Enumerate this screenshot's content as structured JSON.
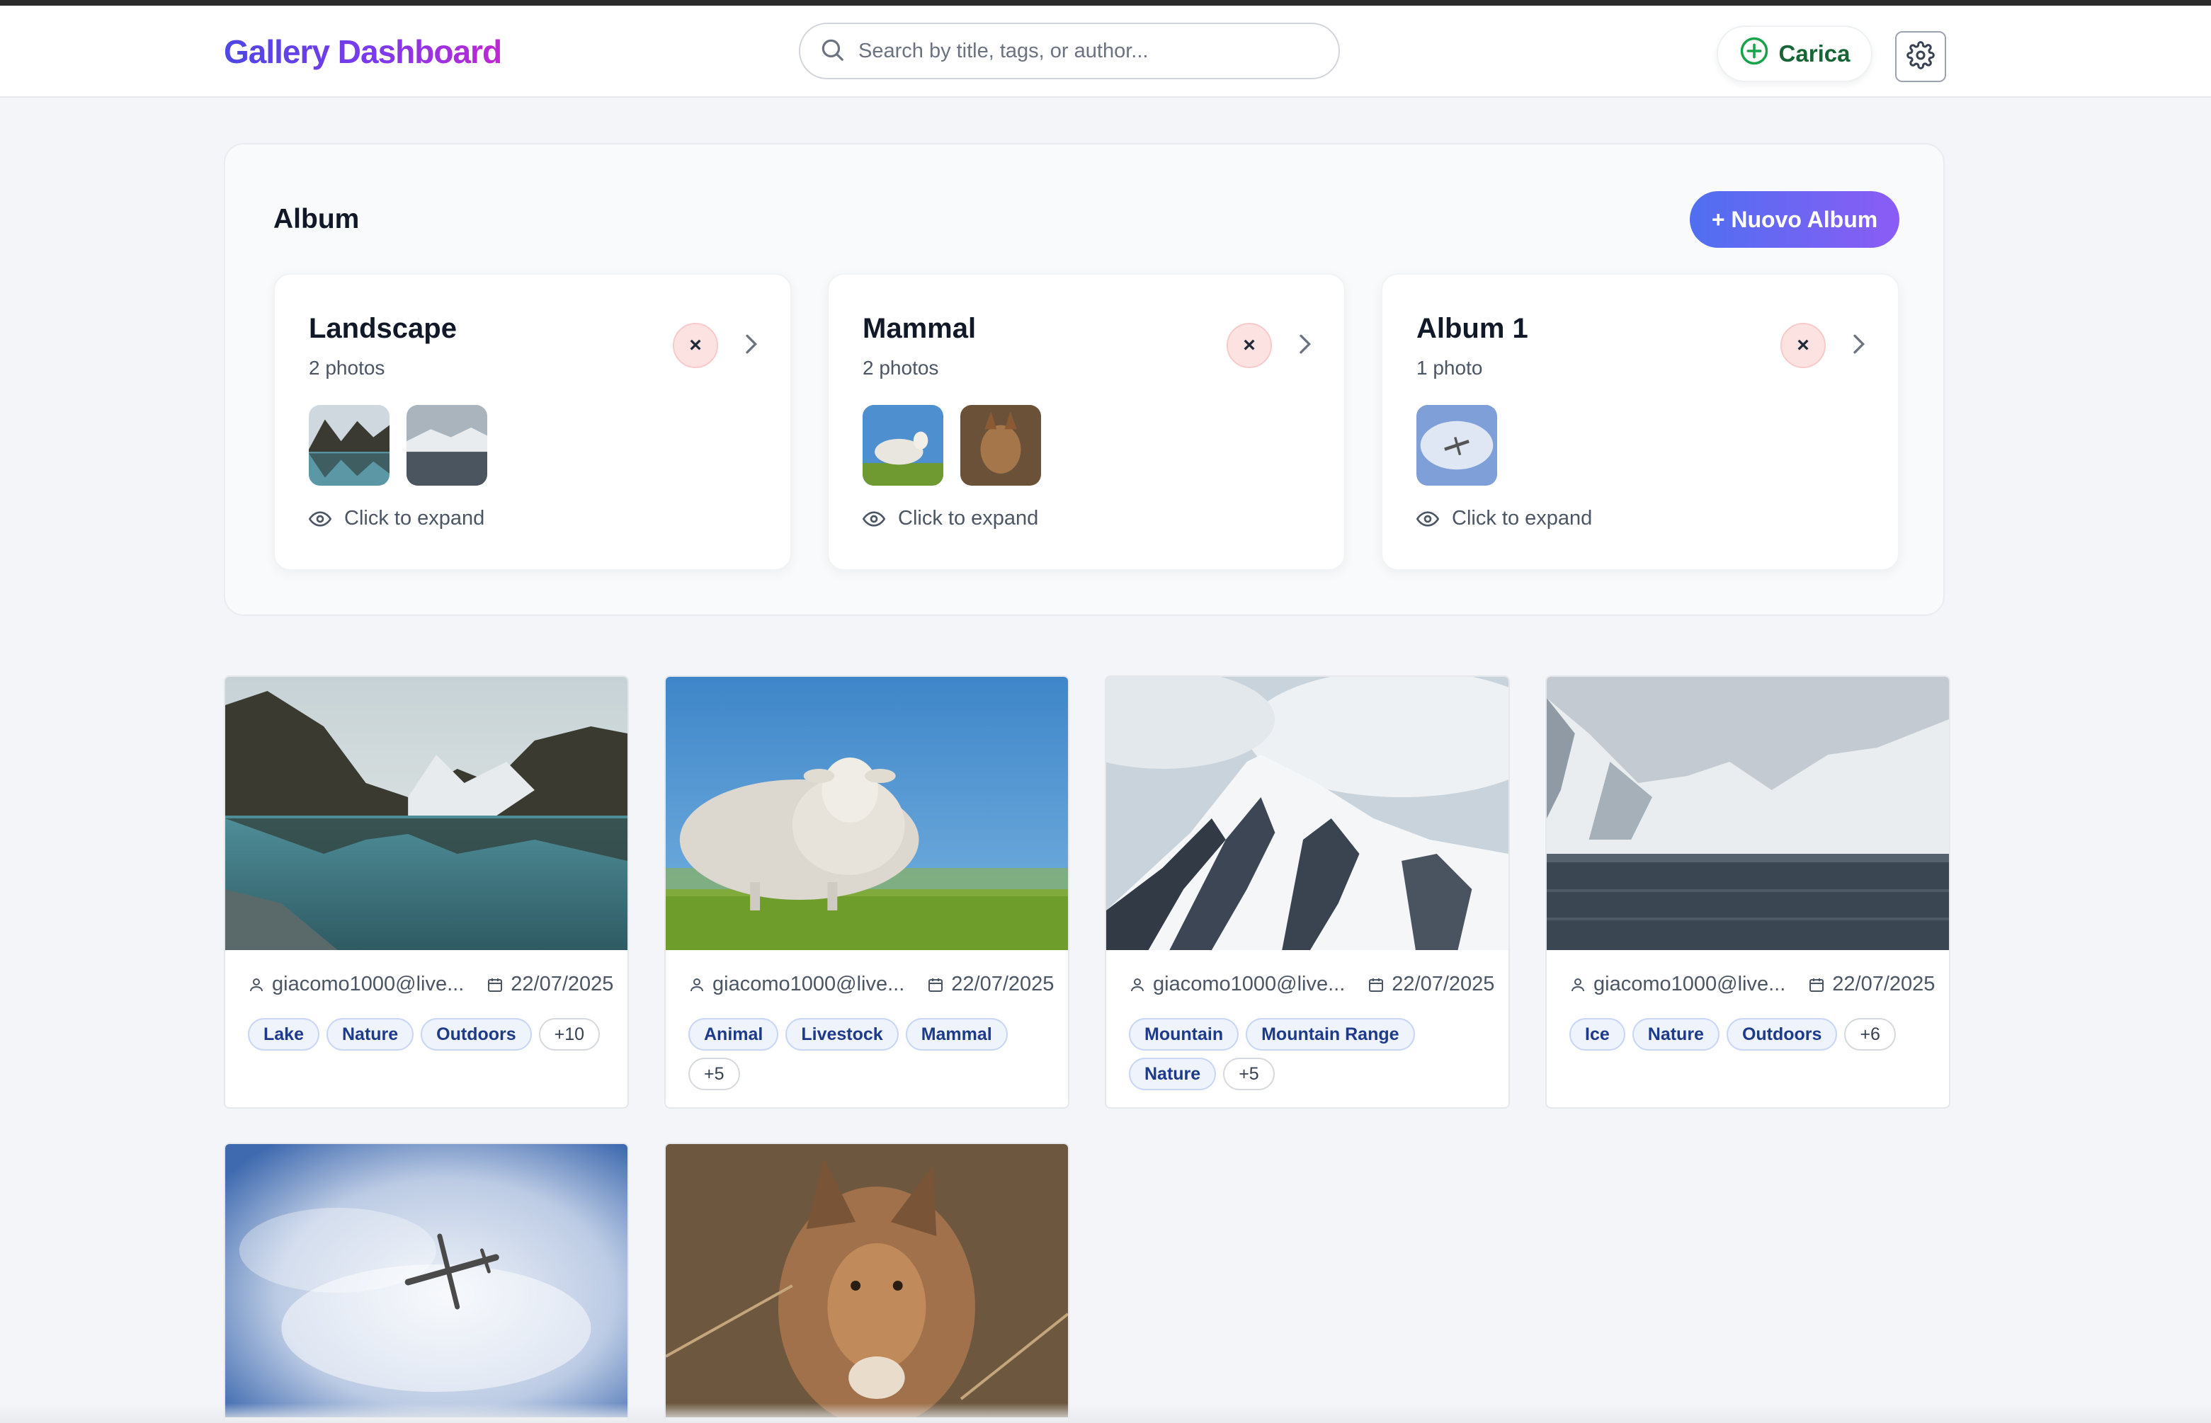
{
  "header": {
    "brand": "Gallery Dashboard",
    "search_placeholder": "Search by title, tags, or author...",
    "upload_label": "Carica"
  },
  "albums": {
    "title": "Album",
    "new_album_label": "+ Nuovo Album",
    "items": [
      {
        "name": "Landscape",
        "count": "2 photos",
        "delete_symbol": "×",
        "expand_label": "Click to expand"
      },
      {
        "name": "Mammal",
        "count": "2 photos",
        "delete_symbol": "×",
        "expand_label": "Click to expand"
      },
      {
        "name": "Album 1",
        "count": "1 photo",
        "delete_symbol": "×",
        "expand_label": "Click to expand"
      }
    ]
  },
  "photos": [
    {
      "author": "giacomo1000@live...",
      "date": "22/07/2025",
      "tags": [
        "Lake",
        "Nature",
        "Outdoors",
        "+10"
      ]
    },
    {
      "author": "giacomo1000@live...",
      "date": "22/07/2025",
      "tags": [
        "Animal",
        "Livestock",
        "Mammal",
        "+5"
      ]
    },
    {
      "author": "giacomo1000@live...",
      "date": "22/07/2025",
      "tags": [
        "Mountain",
        "Mountain Range",
        "Nature",
        "+5"
      ]
    },
    {
      "author": "giacomo1000@live...",
      "date": "22/07/2025",
      "tags": [
        "Ice",
        "Nature",
        "Outdoors",
        "+6"
      ]
    }
  ],
  "icons": {
    "search": "search-icon",
    "upload": "plus-circle-icon",
    "settings": "gear-icon",
    "delete": "close-icon",
    "open": "chevron-right-icon",
    "expand": "eye-icon",
    "author": "user-icon",
    "date": "calendar-icon"
  },
  "colors": {
    "brand_gradient_start": "#4f46e5",
    "brand_gradient_end": "#c026d3",
    "upload_green": "#166534",
    "tag_text": "#1e3a8a",
    "delete_bg": "#fde2e2"
  }
}
